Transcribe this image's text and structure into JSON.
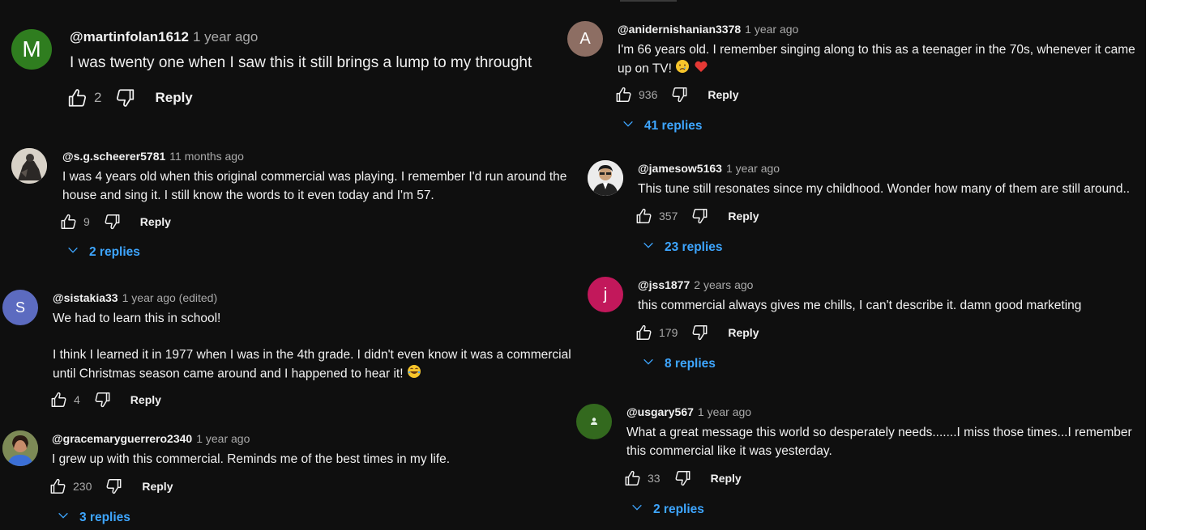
{
  "comments": [
    {
      "author": "@martinfolan1612",
      "time": "1 year ago",
      "text": "I was twenty one when I saw this it still brings a lump to my throught",
      "likes": "2",
      "reply": "Reply",
      "avatar_letter": "M",
      "avatar_color": "#2f7d1f"
    },
    {
      "author": "@s.g.scheerer5781",
      "time": "11 months ago",
      "text": "I was 4 years old when this original commercial was playing. I remember I'd run around the house and sing it. I still know the words to it even today and I'm 57.",
      "likes": "9",
      "reply": "Reply",
      "replies": "2 replies"
    },
    {
      "author": "@sistakia33",
      "time": "1 year ago (edited)",
      "text_line1": "We had to learn this in school!",
      "text_line2": "I think I learned it in 1977 when I was in the 4th grade. I didn't even know it was a commercial until Christmas season came around and I happened to hear it!",
      "likes": "4",
      "reply": "Reply",
      "avatar_letter": "S",
      "avatar_color": "#5c6bc0"
    },
    {
      "author": "@gracemaryguerrero2340",
      "time": "1 year ago",
      "text": "I grew up with this commercial. Reminds me of the best times in my life.",
      "likes": "230",
      "reply": "Reply",
      "replies": "3 replies"
    },
    {
      "author": "@anidernishanian3378",
      "time": "1 year ago",
      "text": "I'm 66 years old. I remember singing along to this as a teenager in the 70s, whenever it came up on TV!",
      "likes": "936",
      "reply": "Reply",
      "replies": "41 replies",
      "avatar_letter": "A",
      "avatar_color": "#8d6e63"
    },
    {
      "author": "@jamesow5163",
      "time": "1 year ago",
      "text": "This tune still resonates since my childhood. Wonder how many of them are still around..",
      "likes": "357",
      "reply": "Reply",
      "replies": "23 replies"
    },
    {
      "author": "@jss1877",
      "time": "2 years ago",
      "text": "this commercial always gives me chills, I can't describe it. damn good marketing",
      "likes": "179",
      "reply": "Reply",
      "replies": "8 replies",
      "avatar_letter": "j",
      "avatar_color": "#c2185b"
    },
    {
      "author": "@usgary567",
      "time": "1 year ago",
      "text": "What a great message this world so desperately needs.......I miss those times...I remember this commercial like it was yesterday.",
      "likes": "33",
      "reply": "Reply",
      "replies": "2 replies",
      "avatar_color": "#33691e"
    }
  ],
  "colors": {
    "background": "#0f0f0f",
    "link": "#3ea6ff",
    "secondary_text": "#aaaaaa"
  },
  "icons": [
    "thumbs-up-icon",
    "thumbs-down-icon",
    "chevron-down-icon",
    "crying-face-emoji",
    "red-heart-emoji",
    "laughing-face-emoji"
  ]
}
